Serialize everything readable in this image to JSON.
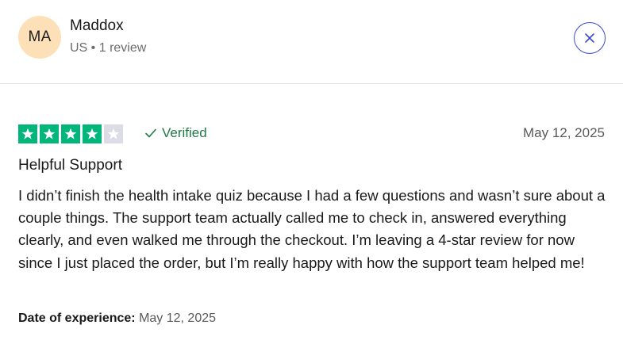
{
  "reviewer": {
    "initials": "MA",
    "name": "Maddox",
    "meta": "US • 1 review"
  },
  "review": {
    "rating": 4,
    "max_rating": 5,
    "verified_label": "Verified",
    "date": "May 12, 2025",
    "title": "Helpful Support",
    "body": "I didn’t finish the health intake quiz because I had a few questions and wasn’t sure about a couple things. The support team actually called me to check in, answered everything clearly, and even walked me through the checkout. I’m leaving a 4-star review for now since I just placed the order, but I’m really happy with how the support team helped me!",
    "experience_label": "Date of experience:",
    "experience_date": "May 12, 2025"
  },
  "colors": {
    "star_filled": "#00b67a",
    "star_empty": "#dcdce6",
    "verified": "#1f7a44",
    "close_accent": "#3b4bd1",
    "avatar_bg": "#fde0b8"
  },
  "icons": {
    "close": "close-icon",
    "verified": "checkmark-icon",
    "star": "star-icon"
  }
}
